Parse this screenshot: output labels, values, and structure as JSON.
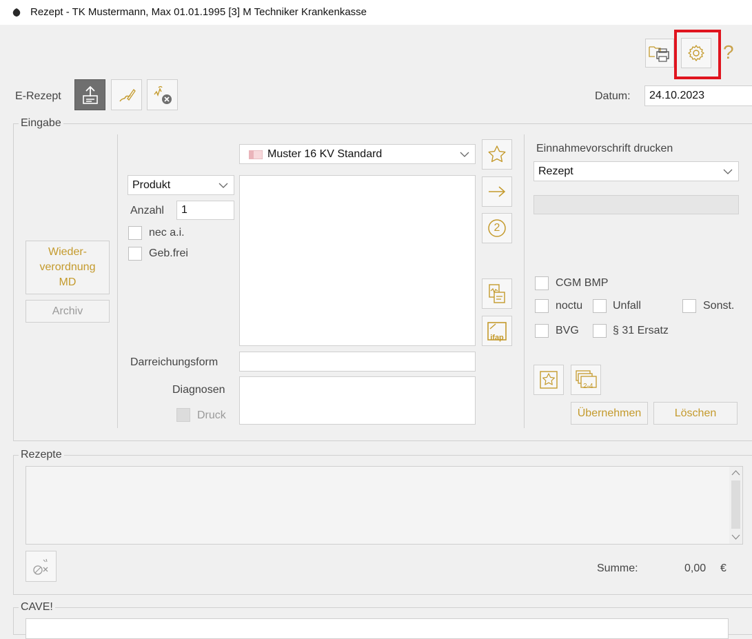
{
  "window": {
    "title": "Rezept - TK Mustermann, Max 01.01.1995 [3] M Techniker Krankenkasse"
  },
  "toolbar": {
    "erezept_label": "E-Rezept",
    "datum_label": "Datum:",
    "datum_value": "24.10.2023",
    "help_glyph": "?"
  },
  "eingabe": {
    "group_title": "Eingabe",
    "wiederverordnung_label": "Wieder-\nverordnung\nMD",
    "archiv_label": "Archiv",
    "template_select": "Muster 16 KV Standard",
    "type_select": "Produkt",
    "anzahl_label": "Anzahl",
    "anzahl_value": "1",
    "nec_label": "nec a.i.",
    "gebfrei_label": "Geb.frei",
    "darreichungsform_label": "Darreichungsform",
    "diagnosen_label": "Diagnosen",
    "druck_label": "Druck",
    "number_badge": "2",
    "ifap_label": "ifap",
    "einnahme_label": "Einnahmevorschrift drucken",
    "einnahme_select": "Rezept",
    "cgm_bmp_label": "CGM BMP",
    "noctu_label": "noctu",
    "unfall_label": "Unfall",
    "sonst_label": "Sonst.",
    "bvg_label": "BVG",
    "ersatz_label": "§ 31 Ersatz",
    "badge_24": "2-4",
    "uebernehmen_label": "Übernehmen",
    "loeschen_label": "Löschen"
  },
  "rezepte": {
    "group_title": "Rezepte",
    "summe_label": "Summe:",
    "summe_value": "0,00",
    "currency": "€"
  },
  "cave": {
    "group_title": "CAVE!"
  },
  "icons": {
    "app": "app-icon",
    "printer_folder": "folder-printer-icon",
    "settings": "gear-icon",
    "help": "help-icon",
    "upload": "upload-icon",
    "sign": "signature-icon",
    "delete_sig": "remove-signature-icon",
    "star": "star-icon",
    "arrow": "arrow-right-icon",
    "two": "number-two-icon"
  },
  "colors": {
    "accent": "#c49a2c",
    "highlight": "#e0141e"
  }
}
